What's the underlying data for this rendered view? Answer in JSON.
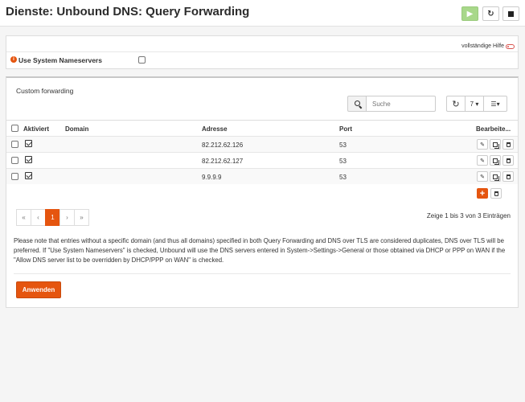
{
  "header": {
    "title": "Dienste: Unbound DNS: Query Forwarding",
    "play_icon": "▶",
    "reload_icon": "↻"
  },
  "settings": {
    "help_label": "vollständige Hilfe",
    "use_system_ns_label": "Use System Nameservers",
    "use_system_ns_checked": false,
    "info_icon": "i"
  },
  "forwarding": {
    "section_title": "Custom forwarding",
    "search_placeholder": "Suche",
    "refresh_icon": "↻",
    "page_size": "7 ▾",
    "columns_label": "☰▾",
    "columns": {
      "enabled": "Aktiviert",
      "domain": "Domain",
      "address": "Adresse",
      "port": "Port",
      "commands": "Bearbeite..."
    },
    "rows": [
      {
        "domain": "",
        "address": "82.212.62.126",
        "port": "53",
        "enabled": true
      },
      {
        "domain": "",
        "address": "82.212.62.127",
        "port": "53",
        "enabled": true
      },
      {
        "domain": "",
        "address": "9.9.9.9",
        "port": "53",
        "enabled": true
      }
    ],
    "edit_icon": "✎",
    "add_icon": "+",
    "pager": {
      "first": "«",
      "prev": "‹",
      "current": "1",
      "next": "›",
      "last": "»"
    },
    "range_info": "Zeige 1 bis 3 von 3 Einträgen"
  },
  "note": "Please note that entries without a specific domain (and thus all domains) specified in both Query Forwarding and DNS over TLS are considered duplicates, DNS over TLS will be preferred. If \"Use System Nameservers\" is checked, Unbound will use the DNS servers entered in System->Settings->General or those obtained via DHCP or PPP on WAN if the \"Allow DNS server list to be overridden by DHCP/PPP on WAN\" is checked.",
  "apply_label": "Anwenden",
  "colors": {
    "accent": "#e5550f",
    "play_green": "#a8d88a"
  }
}
